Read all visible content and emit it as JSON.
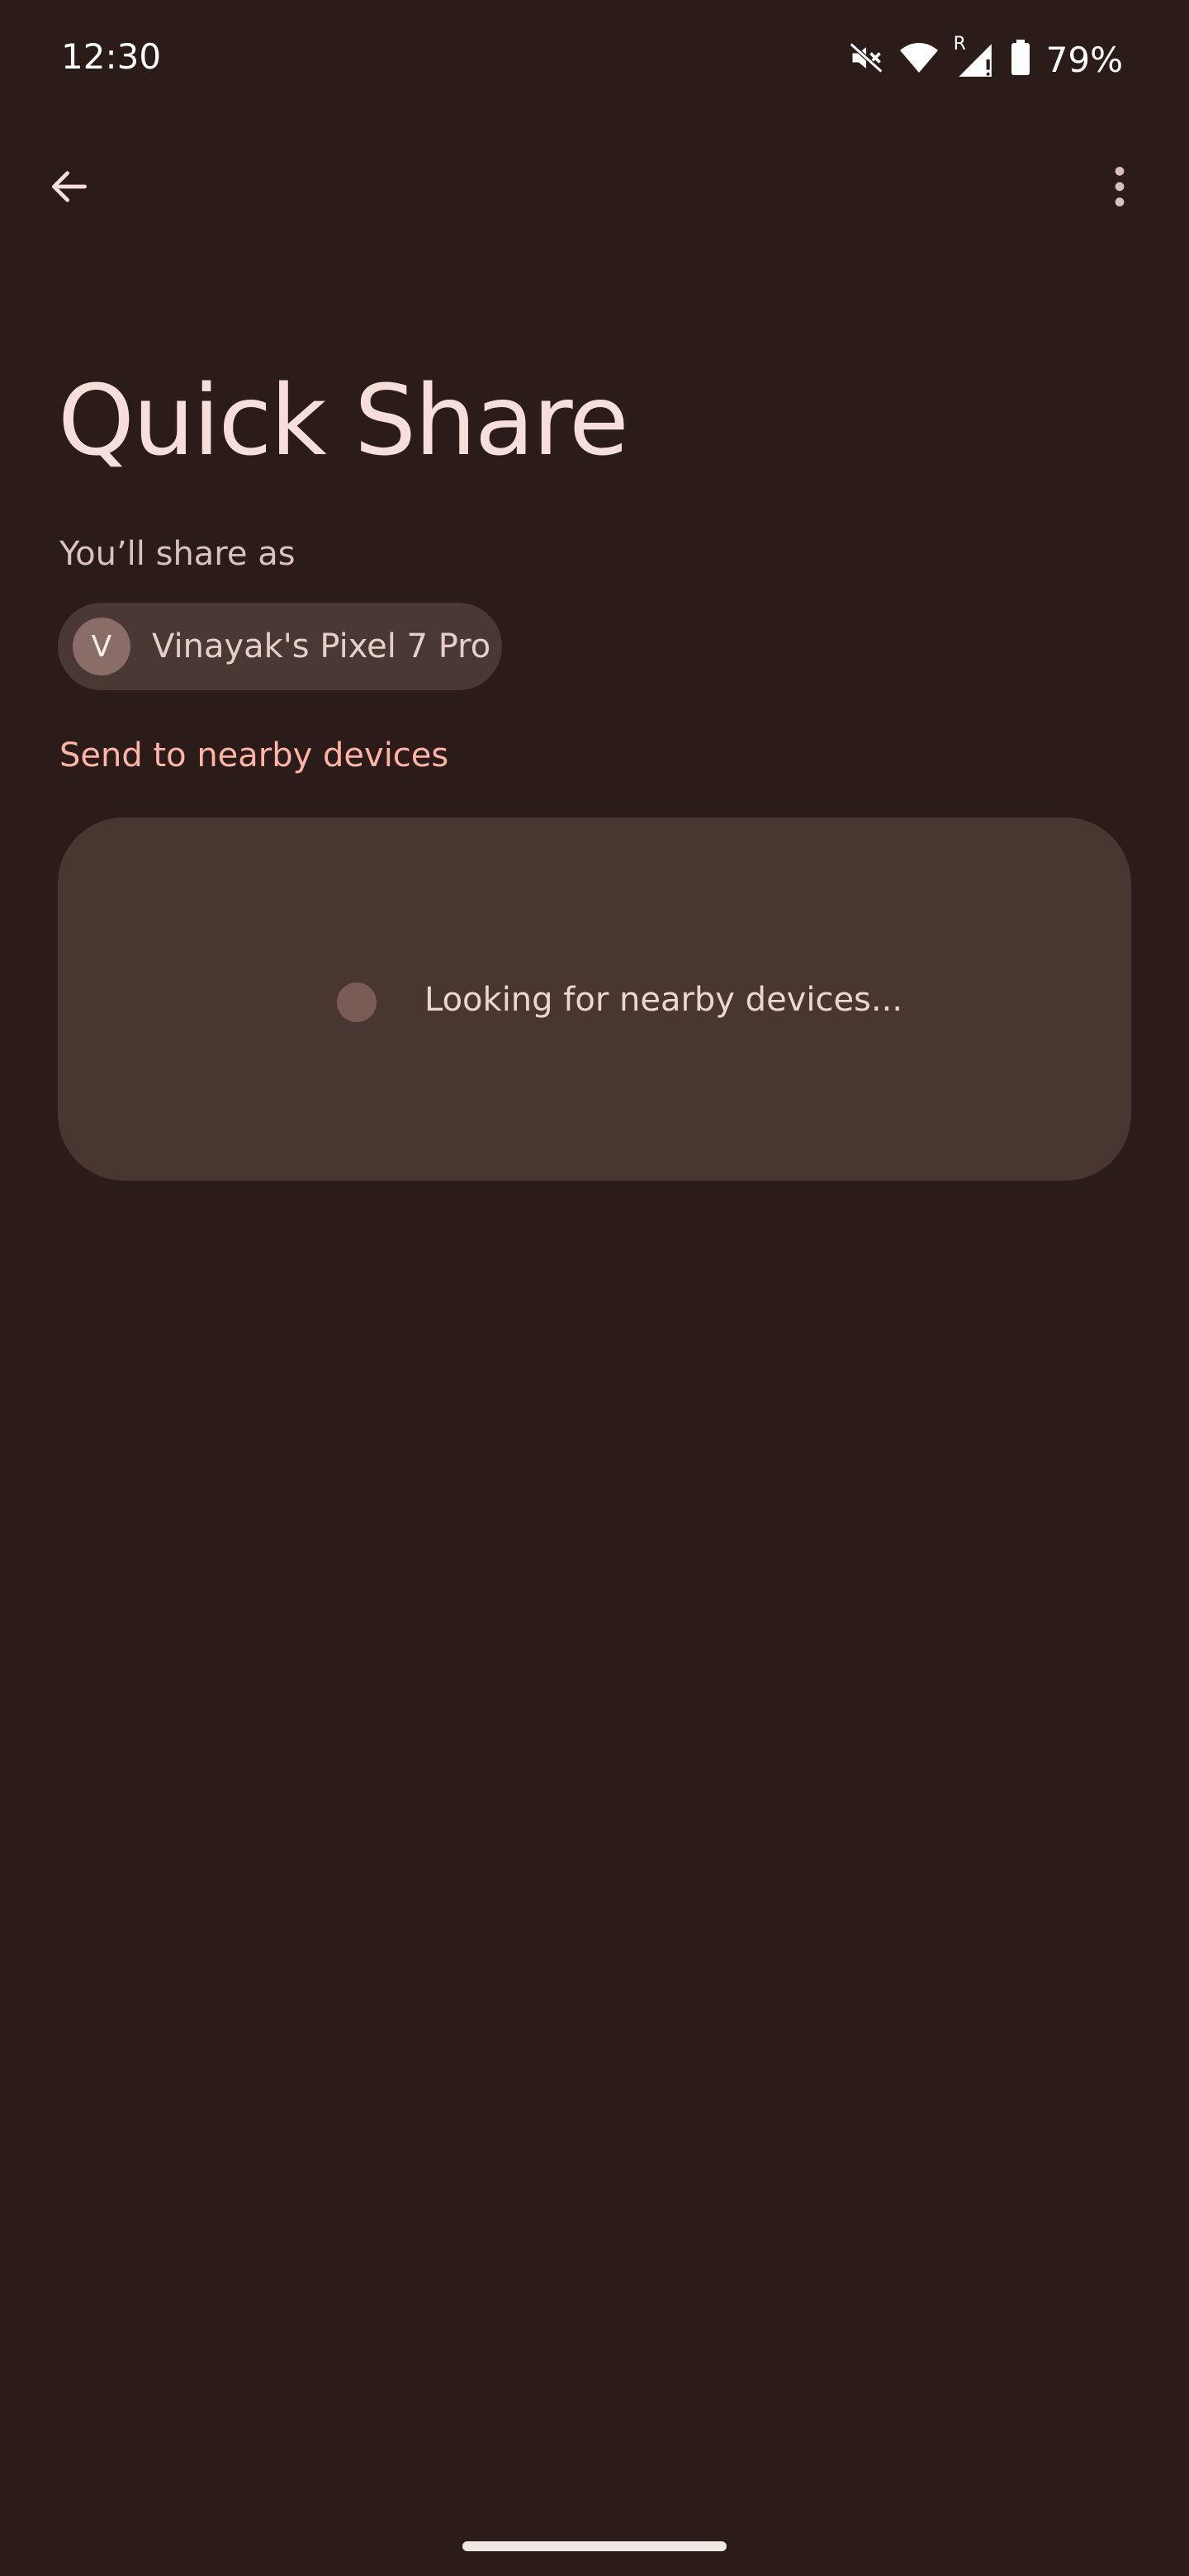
{
  "status_bar": {
    "time": "12:30",
    "battery_percent": "79%",
    "icons": [
      "mute-icon",
      "wifi-icon",
      "signal-roaming-icon",
      "battery-icon"
    ],
    "signal_roaming_label": "R"
  },
  "toolbar": {
    "back_icon": "arrow-back-icon",
    "more_icon": "more-vert-icon"
  },
  "page": {
    "title": "Quick Share",
    "share_as_label": "You’ll share as",
    "device": {
      "avatar_initial": "V",
      "name": "Vinayak's Pixel 7 Pro"
    },
    "section_heading": "Send to nearby devices",
    "search_status": "Looking for nearby devices..."
  },
  "colors": {
    "background": "#2b1b19",
    "accent": "#ffb4a6",
    "card": "#4a3631",
    "chip": "#4a3834"
  }
}
